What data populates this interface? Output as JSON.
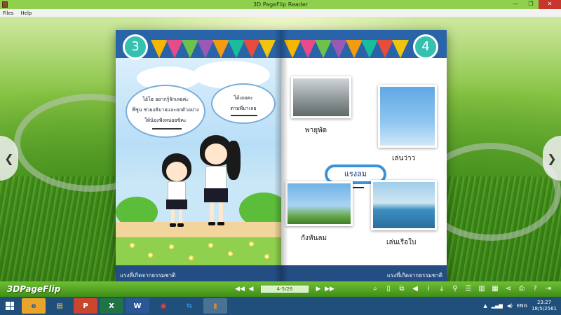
{
  "window": {
    "title": "3D PageFlip Reader",
    "controls": {
      "minimize": "—",
      "restore": "❐",
      "close": "✕"
    }
  },
  "menu": {
    "items": [
      "Files",
      "Help"
    ]
  },
  "book": {
    "left_page": {
      "number": "3",
      "bubble_left": [
        "โอ้โฮ  อยากรู้จักเลยค่ะ",
        "พี่ชูน ช่วยอธิบายและยกตัวอย่าง",
        "ให้น้องฟังหน่อยซิคะ"
      ],
      "bubble_right": [
        "ได้เลยคะ",
        "ตามพี่มาเลย"
      ],
      "footer": "แรงที่เกิดจากธรรมชาติ"
    },
    "right_page": {
      "number": "4",
      "center_label": "แรงลม",
      "captions": {
        "storm": "พายุพัด",
        "kite": "เล่นว่าว",
        "turbine": "กังหันลม",
        "sailboat": "เล่นเรือใบ"
      },
      "footer": "แรงที่เกิดจากธรรมชาติ"
    }
  },
  "toolbar": {
    "brand": "3DPageFlip",
    "pager": "4-5/26",
    "icons": [
      "zoom-icon",
      "single-page-icon",
      "fullscreen-icon",
      "sound-icon",
      "info-icon",
      "download-icon",
      "search-icon",
      "table-of-contents-icon",
      "bookmark-icon",
      "thumbnails-icon",
      "share-icon",
      "print-icon",
      "help-icon",
      "exit-icon"
    ]
  },
  "taskbar": {
    "apps": [
      "internet-explorer",
      "file-explorer",
      "powerpoint",
      "excel",
      "word",
      "chrome",
      "teamviewer",
      "pageflip-reader"
    ],
    "language": "ENG",
    "time": "23:27",
    "date": "18/5/2561"
  },
  "colors": {
    "titlebar": "#8fd14f",
    "toolbar": "#4fa01f",
    "taskbar": "#1f4f7a",
    "page_band": "#2a64a8",
    "page_number_badge": "#35c0b0"
  }
}
